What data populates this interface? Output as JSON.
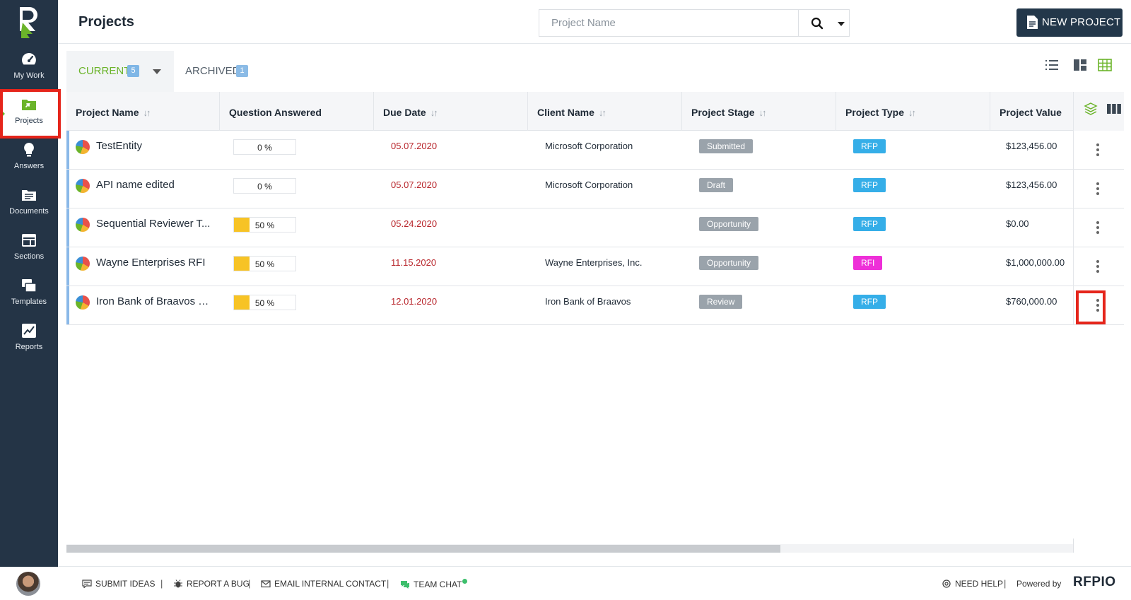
{
  "header": {
    "title": "Projects",
    "search_placeholder": "Project Name",
    "new_project_label": "NEW PROJECT"
  },
  "sidebar": {
    "items": [
      {
        "label": "My Work",
        "icon": "gauge-icon"
      },
      {
        "label": "Projects",
        "icon": "folder-icon",
        "active": true
      },
      {
        "label": "Answers",
        "icon": "lightbulb-icon"
      },
      {
        "label": "Documents",
        "icon": "document-folder-icon"
      },
      {
        "label": "Sections",
        "icon": "sections-icon"
      },
      {
        "label": "Templates",
        "icon": "templates-icon"
      },
      {
        "label": "Reports",
        "icon": "chart-icon"
      }
    ]
  },
  "tabs": {
    "current": {
      "label": "CURRENT",
      "count": "5"
    },
    "archived": {
      "label": "ARCHIVED",
      "count": "1"
    }
  },
  "table": {
    "columns": [
      "Project Name",
      "Question Answered",
      "Due Date",
      "Client Name",
      "Project Stage",
      "Project Type",
      "Project Value"
    ],
    "rows": [
      {
        "name": "TestEntity",
        "progress": 0,
        "progress_label": "0 %",
        "due": "05.07.2020",
        "client": "Microsoft Corporation",
        "stage": "Submitted",
        "type": "RFP",
        "value": "$123,456.00"
      },
      {
        "name": "API name edited",
        "progress": 0,
        "progress_label": "0 %",
        "due": "05.07.2020",
        "client": "Microsoft Corporation",
        "stage": "Draft",
        "type": "RFP",
        "value": "$123,456.00"
      },
      {
        "name": "Sequential Reviewer T...",
        "progress": 50,
        "progress_label": "50 %",
        "due": "05.24.2020",
        "client": "",
        "stage": "Opportunity",
        "type": "RFP",
        "value": "$0.00"
      },
      {
        "name": "Wayne Enterprises RFI",
        "progress": 50,
        "progress_label": "50 %",
        "due": "11.15.2020",
        "client": "Wayne Enterprises, Inc.",
        "stage": "Opportunity",
        "type": "RFI",
        "value": "$1,000,000.00"
      },
      {
        "name": "Iron Bank of Braavos R...",
        "progress": 50,
        "progress_label": "50 %",
        "due": "12.01.2020",
        "client": "Iron Bank of Braavos",
        "stage": "Review",
        "type": "RFP",
        "value": "$760,000.00"
      }
    ]
  },
  "footer": {
    "submit_ideas": "SUBMIT IDEAS",
    "report_bug": "REPORT A BUG",
    "email_contact": "EMAIL INTERNAL CONTACT",
    "team_chat": "TEAM CHAT",
    "need_help": "NEED HELP",
    "powered_by": "Powered by",
    "brand": "RFPIO"
  },
  "colors": {
    "sidebar": "#243446",
    "accent_green": "#6bb42a",
    "stage_gray": "#9aa3ab",
    "type_rfp": "#35aee8",
    "type_rfi": "#ee2fd8",
    "due_red": "#b8262c",
    "progress_yellow": "#f7c325",
    "highlight_red": "#e5251b"
  }
}
